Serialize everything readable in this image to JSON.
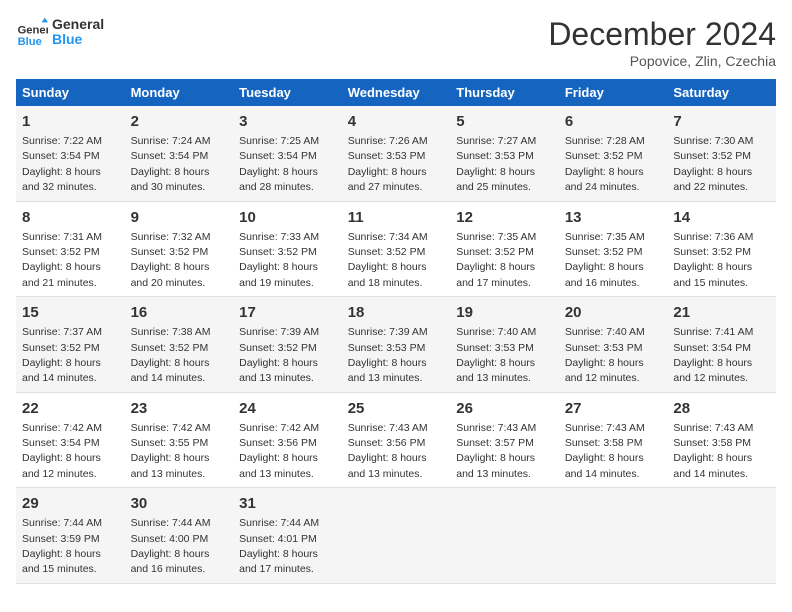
{
  "logo": {
    "line1": "General",
    "line2": "Blue"
  },
  "title": "December 2024",
  "subtitle": "Popovice, Zlin, Czechia",
  "days_header": [
    "Sunday",
    "Monday",
    "Tuesday",
    "Wednesday",
    "Thursday",
    "Friday",
    "Saturday"
  ],
  "weeks": [
    [
      {
        "num": "1",
        "rise": "7:22 AM",
        "set": "3:54 PM",
        "daylight": "8 hours and 32 minutes."
      },
      {
        "num": "2",
        "rise": "7:24 AM",
        "set": "3:54 PM",
        "daylight": "8 hours and 30 minutes."
      },
      {
        "num": "3",
        "rise": "7:25 AM",
        "set": "3:54 PM",
        "daylight": "8 hours and 28 minutes."
      },
      {
        "num": "4",
        "rise": "7:26 AM",
        "set": "3:53 PM",
        "daylight": "8 hours and 27 minutes."
      },
      {
        "num": "5",
        "rise": "7:27 AM",
        "set": "3:53 PM",
        "daylight": "8 hours and 25 minutes."
      },
      {
        "num": "6",
        "rise": "7:28 AM",
        "set": "3:52 PM",
        "daylight": "8 hours and 24 minutes."
      },
      {
        "num": "7",
        "rise": "7:30 AM",
        "set": "3:52 PM",
        "daylight": "8 hours and 22 minutes."
      }
    ],
    [
      {
        "num": "8",
        "rise": "7:31 AM",
        "set": "3:52 PM",
        "daylight": "8 hours and 21 minutes."
      },
      {
        "num": "9",
        "rise": "7:32 AM",
        "set": "3:52 PM",
        "daylight": "8 hours and 20 minutes."
      },
      {
        "num": "10",
        "rise": "7:33 AM",
        "set": "3:52 PM",
        "daylight": "8 hours and 19 minutes."
      },
      {
        "num": "11",
        "rise": "7:34 AM",
        "set": "3:52 PM",
        "daylight": "8 hours and 18 minutes."
      },
      {
        "num": "12",
        "rise": "7:35 AM",
        "set": "3:52 PM",
        "daylight": "8 hours and 17 minutes."
      },
      {
        "num": "13",
        "rise": "7:35 AM",
        "set": "3:52 PM",
        "daylight": "8 hours and 16 minutes."
      },
      {
        "num": "14",
        "rise": "7:36 AM",
        "set": "3:52 PM",
        "daylight": "8 hours and 15 minutes."
      }
    ],
    [
      {
        "num": "15",
        "rise": "7:37 AM",
        "set": "3:52 PM",
        "daylight": "8 hours and 14 minutes."
      },
      {
        "num": "16",
        "rise": "7:38 AM",
        "set": "3:52 PM",
        "daylight": "8 hours and 14 minutes."
      },
      {
        "num": "17",
        "rise": "7:39 AM",
        "set": "3:52 PM",
        "daylight": "8 hours and 13 minutes."
      },
      {
        "num": "18",
        "rise": "7:39 AM",
        "set": "3:53 PM",
        "daylight": "8 hours and 13 minutes."
      },
      {
        "num": "19",
        "rise": "7:40 AM",
        "set": "3:53 PM",
        "daylight": "8 hours and 13 minutes."
      },
      {
        "num": "20",
        "rise": "7:40 AM",
        "set": "3:53 PM",
        "daylight": "8 hours and 12 minutes."
      },
      {
        "num": "21",
        "rise": "7:41 AM",
        "set": "3:54 PM",
        "daylight": "8 hours and 12 minutes."
      }
    ],
    [
      {
        "num": "22",
        "rise": "7:42 AM",
        "set": "3:54 PM",
        "daylight": "8 hours and 12 minutes."
      },
      {
        "num": "23",
        "rise": "7:42 AM",
        "set": "3:55 PM",
        "daylight": "8 hours and 13 minutes."
      },
      {
        "num": "24",
        "rise": "7:42 AM",
        "set": "3:56 PM",
        "daylight": "8 hours and 13 minutes."
      },
      {
        "num": "25",
        "rise": "7:43 AM",
        "set": "3:56 PM",
        "daylight": "8 hours and 13 minutes."
      },
      {
        "num": "26",
        "rise": "7:43 AM",
        "set": "3:57 PM",
        "daylight": "8 hours and 13 minutes."
      },
      {
        "num": "27",
        "rise": "7:43 AM",
        "set": "3:58 PM",
        "daylight": "8 hours and 14 minutes."
      },
      {
        "num": "28",
        "rise": "7:43 AM",
        "set": "3:58 PM",
        "daylight": "8 hours and 14 minutes."
      }
    ],
    [
      {
        "num": "29",
        "rise": "7:44 AM",
        "set": "3:59 PM",
        "daylight": "8 hours and 15 minutes."
      },
      {
        "num": "30",
        "rise": "7:44 AM",
        "set": "4:00 PM",
        "daylight": "8 hours and 16 minutes."
      },
      {
        "num": "31",
        "rise": "7:44 AM",
        "set": "4:01 PM",
        "daylight": "8 hours and 17 minutes."
      },
      null,
      null,
      null,
      null
    ]
  ],
  "labels": {
    "sunrise": "Sunrise:",
    "sunset": "Sunset:",
    "daylight": "Daylight:"
  }
}
